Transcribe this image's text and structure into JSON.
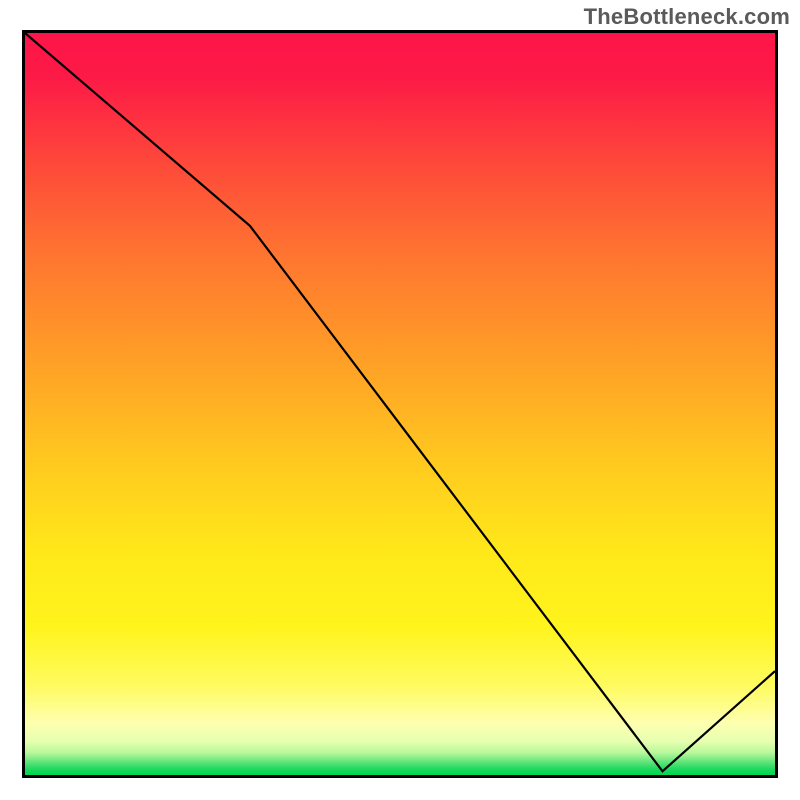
{
  "attribution": "TheBottleneck.com",
  "marker_label": "",
  "chart_data": {
    "type": "line",
    "x_range": [
      0,
      100
    ],
    "y_range": [
      0,
      100
    ],
    "series": [
      {
        "name": "curve",
        "x": [
          0,
          30,
          85,
          100
        ],
        "y": [
          100,
          74,
          0.5,
          14
        ]
      }
    ],
    "notes": "Background is a vertical gradient from red (top) through orange and yellow to a thin green band at the bottom. The black curve starts at the top-left corner, has a slight slope change near x≈30, descends roughly linearly to a minimum near x≈85 at the very bottom (green region), then rises toward the right edge. A small red text label sits at the curve's minimum near the bottom."
  }
}
